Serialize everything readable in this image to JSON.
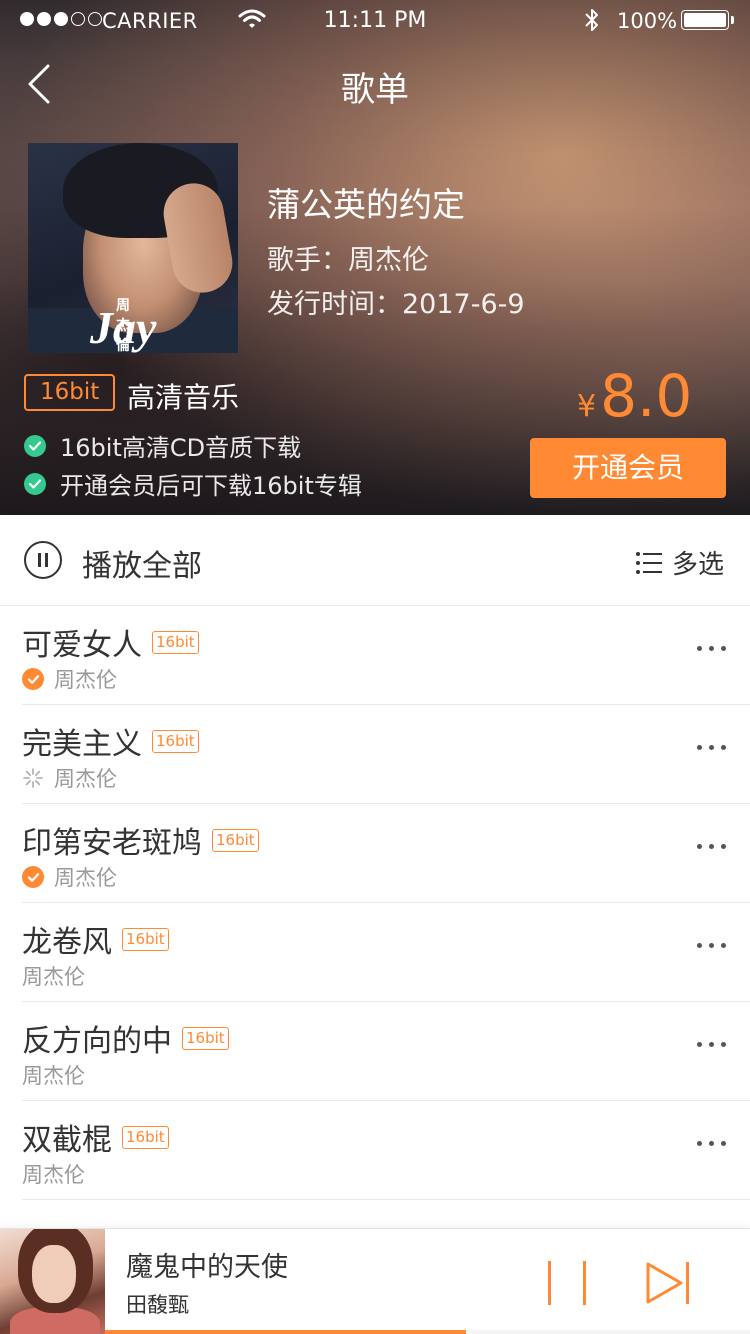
{
  "status_bar": {
    "carrier": "CARRIER",
    "time": "11:11 PM",
    "battery": "100%",
    "signal_filled": 3,
    "signal_total": 5
  },
  "nav": {
    "title": "歌单"
  },
  "album": {
    "title": "蒲公英的约定",
    "artist": "歌手：周杰伦",
    "release": "发行时间：2017-6-9",
    "cover_text_zh": "周杰倫",
    "cover_text_en": "Jay"
  },
  "quality": {
    "badge": "16bit",
    "label": "高清音乐",
    "features": [
      "16bit高清CD音质下载",
      "开通会员后可下载16bit专辑"
    ]
  },
  "purchase": {
    "currency": "¥",
    "price": "8.0",
    "button": "开通会员"
  },
  "list_header": {
    "play_all": "播放全部",
    "multi_select": "多选"
  },
  "songs": [
    {
      "title": "可爱女人",
      "tag": "16bit",
      "artist": "周杰伦",
      "status": "downloaded"
    },
    {
      "title": "完美主义",
      "tag": "16bit",
      "artist": "周杰伦",
      "status": "downloading"
    },
    {
      "title": "印第安老斑鸠",
      "tag": "16bit",
      "artist": "周杰伦",
      "status": "downloaded"
    },
    {
      "title": "龙卷风",
      "tag": "16bit",
      "artist": "周杰伦",
      "status": "none"
    },
    {
      "title": "反方向的中",
      "tag": "16bit",
      "artist": "周杰伦",
      "status": "none"
    },
    {
      "title": "双截棍",
      "tag": "16bit",
      "artist": "周杰伦",
      "status": "none"
    }
  ],
  "player": {
    "title": "魔鬼中的天使",
    "artist": "田馥甄",
    "progress": 0.56
  },
  "colors": {
    "accent": "#ff8a33",
    "check_green": "#35c88f",
    "text_primary": "#333333",
    "text_secondary": "#999999"
  }
}
